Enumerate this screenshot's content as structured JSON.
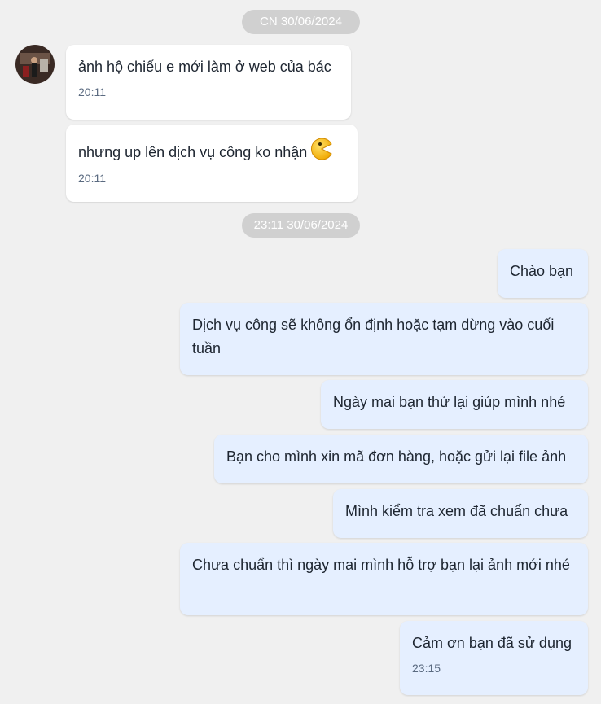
{
  "dividers": [
    "CN 30/06/2024",
    "23:11 30/06/2024"
  ],
  "contact": {
    "avatar_icon": "user-avatar-photo"
  },
  "messages": [
    {
      "direction": "in",
      "text": "ảnh hộ chiếu e mới làm ở web của bác",
      "time": "20:11"
    },
    {
      "direction": "in",
      "text": "nhưng up lên dịch vụ công ko nhận",
      "emoji": "pacman-face-emoji",
      "time": "20:11"
    },
    {
      "direction": "out",
      "text": "Chào bạn"
    },
    {
      "direction": "out",
      "text": "Dịch vụ công sẽ không ổn định hoặc tạm dừng vào cuối tuần"
    },
    {
      "direction": "out",
      "text": "Ngày mai bạn thử lại giúp mình nhé"
    },
    {
      "direction": "out",
      "text": "Bạn cho mình xin mã đơn hàng, hoặc gửi lại file ảnh"
    },
    {
      "direction": "out",
      "text": "Mình kiểm tra xem đã chuẩn chưa"
    },
    {
      "direction": "out",
      "text": "Chưa chuẩn thì ngày mai mình hỗ trợ bạn lại ảnh mới nhé"
    },
    {
      "direction": "out",
      "text": "Cảm ơn bạn đã sử dụng",
      "time": "23:15"
    }
  ],
  "colors": {
    "background": "#f0f0f0",
    "incoming_bubble": "#ffffff",
    "outgoing_bubble": "#e5efff",
    "date_pill": "#d0d0d0"
  }
}
